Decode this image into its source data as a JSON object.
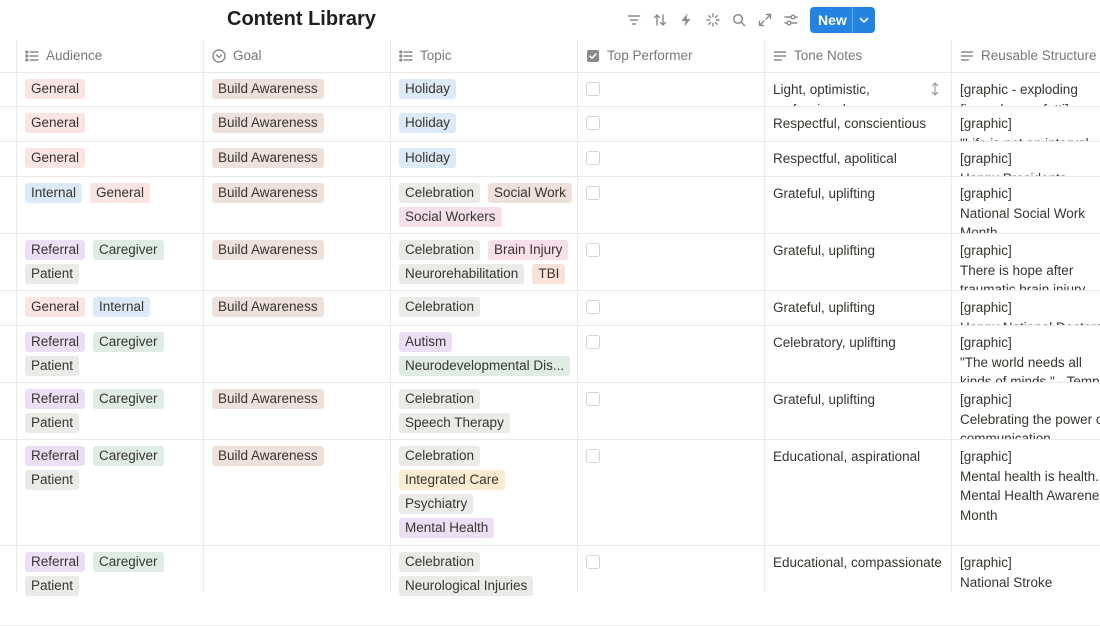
{
  "page": {
    "title": "Content Library"
  },
  "toolbar": {
    "new_label": "New",
    "icons": [
      "filter-icon",
      "sort-icon",
      "automation-icon",
      "ai-sparkle-icon",
      "search-icon",
      "expand-icon",
      "settings-sliders-icon"
    ]
  },
  "columns": [
    {
      "label": "Audience",
      "icon": "multi-select-icon"
    },
    {
      "label": "Goal",
      "icon": "select-icon"
    },
    {
      "label": "Topic",
      "icon": "multi-select-icon"
    },
    {
      "label": "Top Performer",
      "icon": "checkbox-icon"
    },
    {
      "label": "Tone Notes",
      "icon": "text-icon"
    },
    {
      "label": "Reusable Structure",
      "icon": "text-icon"
    }
  ],
  "colors": {
    "accent": "#2383e2",
    "tag_red": "#fbe4e4",
    "tag_blue": "#dce9f7",
    "tag_purple": "#ecdff5",
    "tag_green": "#dfece4",
    "tag_gray": "#ebeae8",
    "tag_brown": "#eee0da",
    "tag_pink": "#f6dfea",
    "tag_orange": "#fbe2d6",
    "tag_yellow": "#fbecd1"
  },
  "rows": [
    {
      "audience": [
        {
          "label": "General",
          "color": "red"
        }
      ],
      "goal": [
        {
          "label": "Build Awareness",
          "color": "brown"
        }
      ],
      "topic": [
        {
          "label": "Holiday",
          "color": "blue"
        }
      ],
      "top_performer": false,
      "tone": "Light, optimistic,\nprofessional",
      "structure": "[graphic - exploding\nfireworks, confetti]"
    },
    {
      "audience": [
        {
          "label": "General",
          "color": "red"
        }
      ],
      "goal": [
        {
          "label": "Build Awareness",
          "color": "brown"
        }
      ],
      "topic": [
        {
          "label": "Holiday",
          "color": "blue"
        }
      ],
      "top_performer": false,
      "tone": "Respectful, conscientious",
      "structure": "[graphic]\n\"Life is not an interval"
    },
    {
      "audience": [
        {
          "label": "General",
          "color": "red"
        }
      ],
      "goal": [
        {
          "label": "Build Awareness",
          "color": "brown"
        }
      ],
      "topic": [
        {
          "label": "Holiday",
          "color": "blue"
        }
      ],
      "top_performer": false,
      "tone": "Respectful, apolitical",
      "structure": "[graphic]\nHappy Presidents"
    },
    {
      "audience": [
        {
          "label": "Internal",
          "color": "blue"
        },
        {
          "label": "General",
          "color": "red"
        }
      ],
      "goal": [
        {
          "label": "Build Awareness",
          "color": "brown"
        }
      ],
      "topic": [
        {
          "label": "Celebration",
          "color": "gray"
        },
        {
          "label": "Social Work",
          "color": "brown"
        },
        {
          "label": "Social Workers",
          "color": "pink"
        }
      ],
      "top_performer": false,
      "tone": "Grateful, uplifting",
      "structure": "[graphic]\nNational Social Work\nMonth"
    },
    {
      "audience": [
        {
          "label": "Referral",
          "color": "purple"
        },
        {
          "label": "Caregiver",
          "color": "green"
        },
        {
          "label": "Patient",
          "color": "gray"
        }
      ],
      "goal": [
        {
          "label": "Build Awareness",
          "color": "brown"
        }
      ],
      "topic": [
        {
          "label": "Celebration",
          "color": "gray"
        },
        {
          "label": "Brain Injury",
          "color": "pink"
        },
        {
          "label": "Neurorehabilitation",
          "color": "gray"
        },
        {
          "label": "TBI",
          "color": "orange"
        }
      ],
      "top_performer": false,
      "tone": "Grateful, uplifting",
      "structure": "[graphic]\nThere is hope after\ntraumatic brain injury"
    },
    {
      "audience": [
        {
          "label": "General",
          "color": "red"
        },
        {
          "label": "Internal",
          "color": "blue"
        }
      ],
      "goal": [
        {
          "label": "Build Awareness",
          "color": "brown"
        }
      ],
      "topic": [
        {
          "label": "Celebration",
          "color": "gray"
        }
      ],
      "top_performer": false,
      "tone": "Grateful, uplifting",
      "structure": "[graphic]\nHappy National Doctors"
    },
    {
      "audience": [
        {
          "label": "Referral",
          "color": "purple"
        },
        {
          "label": "Caregiver",
          "color": "green"
        },
        {
          "label": "Patient",
          "color": "gray"
        }
      ],
      "goal": [],
      "topic": [
        {
          "label": "Autism",
          "color": "purple"
        },
        {
          "label": "Neurodevelopmental Dis...",
          "color": "green"
        }
      ],
      "top_performer": false,
      "tone": "Celebratory, uplifting",
      "structure": "[graphic]\n\"The world needs all\nkinds of minds.\" - Temple"
    },
    {
      "audience": [
        {
          "label": "Referral",
          "color": "purple"
        },
        {
          "label": "Caregiver",
          "color": "green"
        },
        {
          "label": "Patient",
          "color": "gray"
        }
      ],
      "goal": [
        {
          "label": "Build Awareness",
          "color": "brown"
        }
      ],
      "topic": [
        {
          "label": "Celebration",
          "color": "gray"
        },
        {
          "label": "Speech Therapy",
          "color": "gray"
        }
      ],
      "top_performer": false,
      "tone": "Grateful, uplifting",
      "structure": "[graphic]\nCelebrating the power of\ncommunication"
    },
    {
      "audience": [
        {
          "label": "Referral",
          "color": "purple"
        },
        {
          "label": "Caregiver",
          "color": "green"
        },
        {
          "label": "Patient",
          "color": "gray"
        }
      ],
      "goal": [
        {
          "label": "Build Awareness",
          "color": "brown"
        }
      ],
      "topic": [
        {
          "label": "Celebration",
          "color": "gray"
        },
        {
          "label": "Integrated Care",
          "color": "yellow"
        },
        {
          "label": "Psychiatry",
          "color": "gray"
        },
        {
          "label": "Mental Health",
          "color": "purple"
        }
      ],
      "top_performer": false,
      "tone": "Educational, aspirational",
      "structure": "[graphic]\nMental health is health.\nMental Health Awareness\nMonth"
    },
    {
      "audience": [
        {
          "label": "Referral",
          "color": "purple"
        },
        {
          "label": "Caregiver",
          "color": "green"
        },
        {
          "label": "Patient",
          "color": "gray"
        }
      ],
      "goal": [],
      "topic": [
        {
          "label": "Celebration",
          "color": "gray"
        },
        {
          "label": "Neurological Injuries",
          "color": "gray"
        }
      ],
      "top_performer": false,
      "tone": "Educational, compassionate",
      "structure": "[graphic]\nNational Stroke"
    }
  ]
}
